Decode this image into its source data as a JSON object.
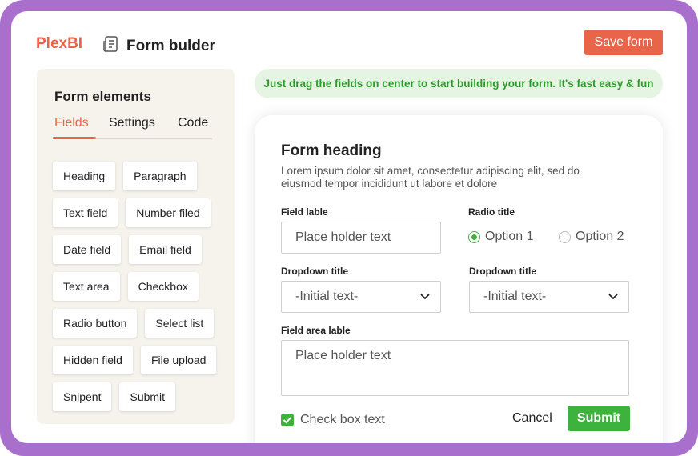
{
  "header": {
    "logo": "PlexBI",
    "page_title": "Form bulder",
    "page_icon": "document-icon",
    "save_label": "Save form"
  },
  "sidebar": {
    "title": "Form elements",
    "tabs": [
      {
        "label": "Fields",
        "active": true
      },
      {
        "label": "Settings",
        "active": false
      },
      {
        "label": "Code",
        "active": false
      }
    ],
    "elements": [
      "Heading",
      "Paragraph",
      "Text field",
      "Number filed",
      "Date field",
      "Email field",
      "Text area",
      "Checkbox",
      "Radio button",
      "Select list",
      "Hidden field",
      "File upload",
      "Snipent",
      "Submit"
    ]
  },
  "tip": "Just drag the fields on center to start building your form. It's fast easy & fun",
  "form": {
    "heading": "Form heading",
    "description": "Lorem ipsum dolor sit amet, consectetur adipiscing elit, sed do eiusmod tempor incididunt ut labore et dolore",
    "field_label": "Field lable",
    "field_placeholder": "Place holder text",
    "radio_title": "Radio title",
    "radio_options": [
      {
        "label": "Option 1",
        "selected": true
      },
      {
        "label": "Option 2",
        "selected": false
      }
    ],
    "dropdown1": {
      "title": "Dropdown title",
      "value": "-Initial text-"
    },
    "dropdown2": {
      "title": "Dropdown title",
      "value": "-Initial text-"
    },
    "area_label": "Field area lable",
    "area_placeholder": "Place holder text",
    "checkbox_label": "Check box text",
    "checkbox_checked": true,
    "cancel_label": "Cancel",
    "submit_label": "Submit"
  },
  "colors": {
    "frame": "#a86fcc",
    "accent": "#e8654a",
    "success": "#3db33d",
    "tip_bg": "#e5f4e3",
    "panel_bg": "#f6f3ed"
  }
}
